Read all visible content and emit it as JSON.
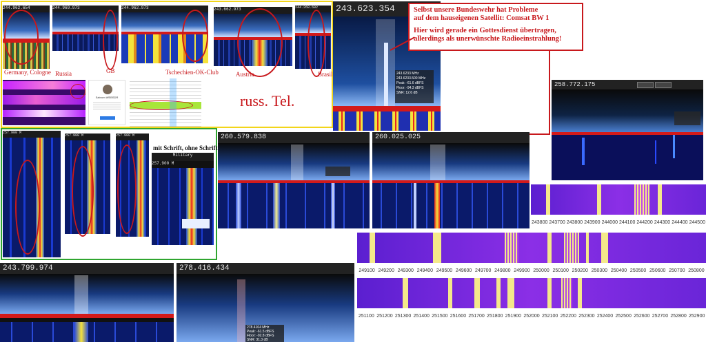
{
  "annotation": {
    "line1": "Selbst unsere Bundeswehr hat Probleme",
    "line2": "auf dem hauseigenen Satellit: Comsat BW 1",
    "line3": "Hier wird gerade ein Gottesdienst übertragen,",
    "line4": "allerdings als unerwünschte Radioeinstrahlung!"
  },
  "labels": {
    "germany": "Germany, Cologne",
    "russia": "Russia",
    "gb": "GB",
    "tschechien": "Tschechien-OK-Club",
    "austria": "Austria",
    "brasil": "Brasil",
    "russ_tel": "russ. Tel.",
    "schrift": "mit Schrift, ohne Schrift",
    "profile_name": "Sabrom WEBSDR"
  },
  "readouts": {
    "main": "243.623.354",
    "right_top": "258.772.175",
    "mid1": "260.579.838",
    "mid2": "260.025.025",
    "bottom1": "243.799.974",
    "bottom2": "278.416.434",
    "thumb1": "244.962.654",
    "thumb2": "244.969.973",
    "thumb3": "244.962.973",
    "thumb4": "243.662.973",
    "thumb5": "244.268.602",
    "wf_a": "257.900 M",
    "wf_b": "257.900 M",
    "wf_c": "257.900 M",
    "wf_d": "257.900 M",
    "mil": "Military"
  },
  "main_info": {
    "l1": "243.6233 MHz",
    "l2": "243.6233.500 MHz",
    "l3": "Peak: -61.6 dBFS",
    "l4": "Floor: -94.3 dBFS",
    "l5": "SNR: 12.6 dB"
  },
  "bottom2_info": {
    "l1": "278.4164 MHz",
    "l2": "Peak: -61.5 dBFS",
    "l3": "Floor: -92.8 dBFS",
    "l4": "SNR: 31.3 dB"
  },
  "scale1": [
    "243800",
    "243700",
    "243800",
    "243900",
    "244000",
    "244100",
    "244200",
    "244300",
    "244400",
    "244500"
  ],
  "scale2": [
    "249100",
    "249200",
    "249300",
    "249400",
    "249500",
    "249600",
    "249700",
    "249800",
    "249900",
    "250000",
    "250100",
    "250200",
    "250300",
    "250400",
    "250500",
    "250600",
    "250700",
    "250800"
  ],
  "scale3": [
    "251100",
    "251200",
    "251300",
    "251400",
    "251500",
    "251600",
    "251700",
    "251800",
    "251900",
    "252000",
    "252100",
    "252200",
    "252300",
    "252400",
    "252500",
    "252600",
    "252700",
    "252800",
    "252900"
  ],
  "colors": {
    "red": "#c8181c",
    "yellow_frame": "#f2d51a",
    "green_frame": "#2fa52f"
  }
}
